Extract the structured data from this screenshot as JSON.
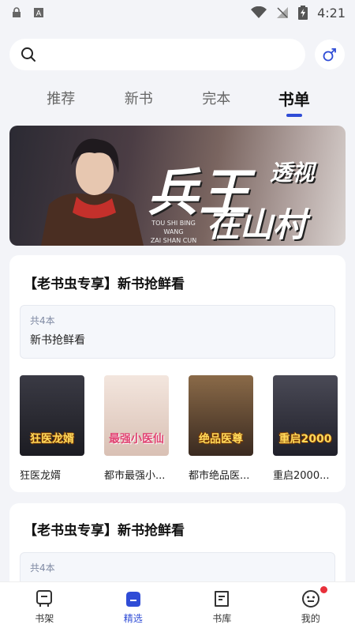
{
  "status_bar": {
    "time": "4:21",
    "icons": [
      "lock-icon",
      "text-icon",
      "wifi-icon",
      "no-signal-icon",
      "battery-charging-icon"
    ]
  },
  "search": {
    "placeholder": ""
  },
  "tabs": [
    {
      "label": "推荐",
      "active": false
    },
    {
      "label": "新书",
      "active": false
    },
    {
      "label": "完本",
      "active": false
    },
    {
      "label": "书单",
      "active": true
    }
  ],
  "banner": {
    "big_title": "兵王",
    "tag": "透视",
    "subtitle": "在山村",
    "pinyin_line1": "TOU SHI BING WANG",
    "pinyin_line2": "ZAI SHAN CUN"
  },
  "lists": [
    {
      "title": "【老书虫专享】新书抢鲜看",
      "count": "共4本",
      "desc": "新书抢鲜看",
      "books": [
        {
          "name": "狂医龙婿",
          "cover_text": "狂医龙婿",
          "bg": "#2a2a30"
        },
        {
          "name": "都市最强小...",
          "cover_text": "最强小医仙",
          "bg": "#e8d8d0"
        },
        {
          "name": "都市绝品医...",
          "cover_text": "绝品医尊",
          "bg": "#5a4a3a"
        },
        {
          "name": "重启2000...",
          "cover_text": "重启2000",
          "bg": "#3c3a44"
        }
      ]
    },
    {
      "title": "【老书虫专享】新书抢鲜看",
      "count": "共4本",
      "desc": ""
    }
  ],
  "bottom_nav": [
    {
      "label": "书架",
      "icon": "bookshelf-icon",
      "active": false
    },
    {
      "label": "精选",
      "icon": "featured-icon",
      "active": true
    },
    {
      "label": "书库",
      "icon": "library-icon",
      "active": false
    },
    {
      "label": "我的",
      "icon": "profile-icon",
      "active": false,
      "badge": true
    }
  ],
  "colors": {
    "accent": "#2f4cd6",
    "background": "#f3f4f8",
    "badge": "#e8303a"
  }
}
